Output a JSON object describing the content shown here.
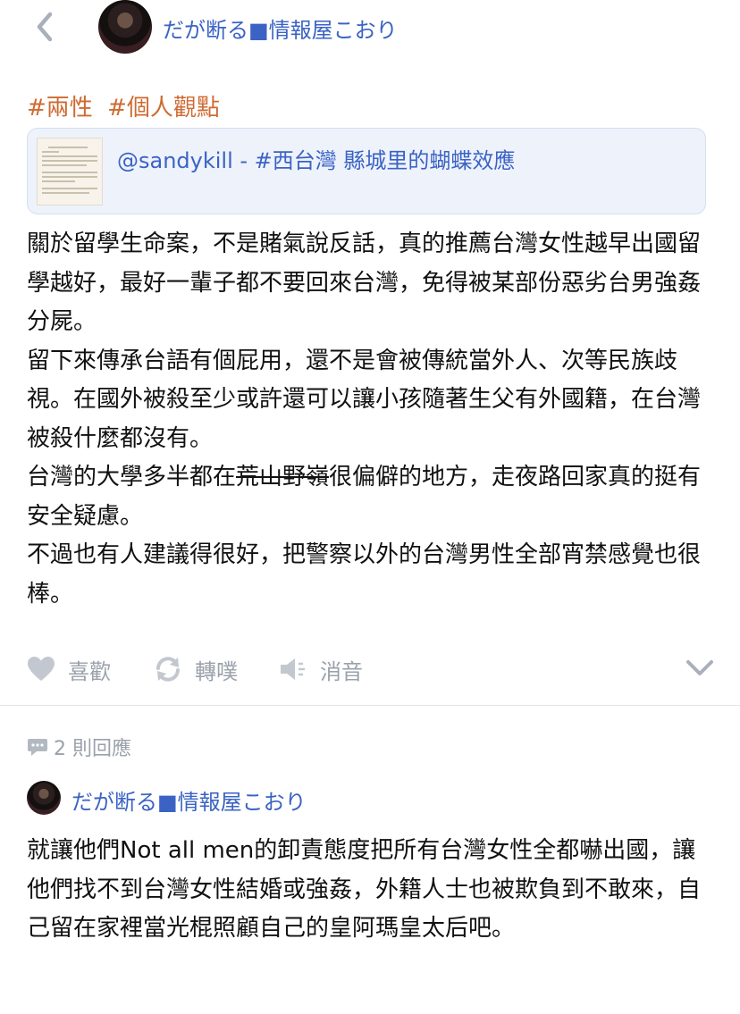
{
  "header": {
    "back_icon": "chevron-left-icon",
    "author": "だが断る■情報屋こおり"
  },
  "post": {
    "tags": [
      "#兩性",
      "#個人觀點"
    ],
    "link_card": {
      "title": "@sandykill - #西台灣 縣城里的蝴蝶效應"
    },
    "paragraphs": [
      "關於留學生命案，不是賭氣說反話，真的推薦台灣女性越早出國留學越好，最好一輩子都不要回來台灣，免得被某部份惡劣台男強姦分屍。",
      "留下來傳承台語有個屁用，還不是會被傳統當外人、次等民族歧視。在國外被殺至少或許還可以讓小孩隨著生父有外國籍，在台灣被殺什麼都沒有。"
    ],
    "p3_before": "台灣的大學多半都在",
    "p3_strike": "荒山野嶺",
    "p3_after": "很偏僻的地方，走夜路回家真的挺有安全疑慮。",
    "p4": "不過也有人建議得很好，把警察以外的台灣男性全部宵禁感覺也很棒。",
    "actions": {
      "like": "喜歡",
      "reshare": "轉噗",
      "mute": "消音"
    }
  },
  "replies": {
    "count_label": "2 則回應",
    "items": [
      {
        "author": "だが断る■情報屋こおり",
        "text": "就讓他們Not all men的卸責態度把所有台灣女性全都嚇出國，讓他們找不到台灣女性結婚或強姦，外籍人士也被欺負到不敢來，自己留在家裡當光棍照顧自己的皇阿瑪皇太后吧。"
      }
    ]
  },
  "colors": {
    "link": "#3b63c4",
    "tag": "#cf6a31",
    "muted": "#9aa1ab",
    "card_bg": "#eef2fb"
  }
}
